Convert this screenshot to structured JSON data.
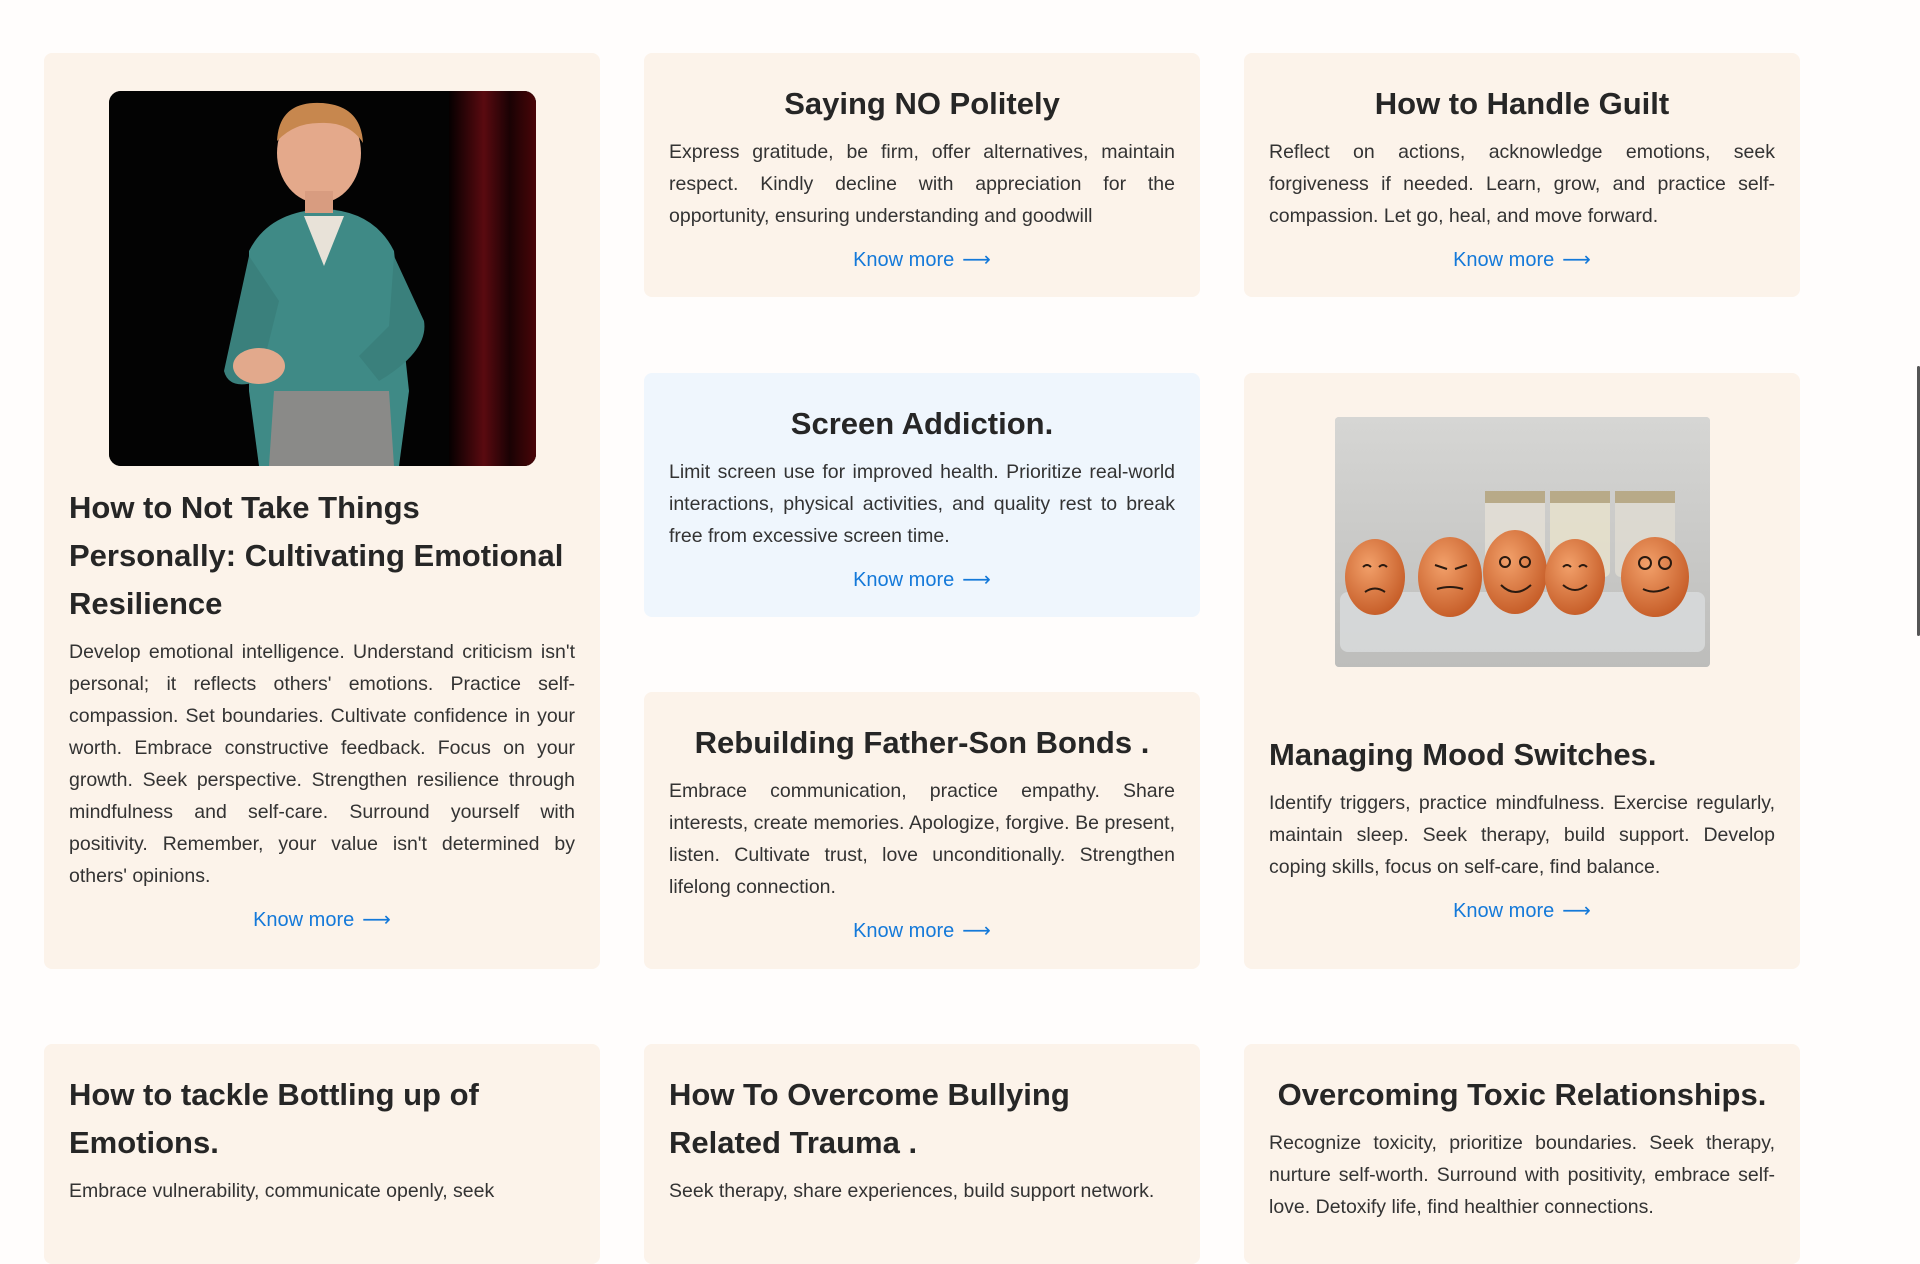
{
  "cards": [
    {
      "title": "How to Not Take Things Personally: Cultivating Emotional Resilience",
      "body": "Develop emotional intelligence. Understand criticism isn't personal; it reflects others' emotions. Practice self-compassion. Set boundaries. Cultivate confidence in your worth. Embrace constructive feedback. Focus on your growth. Seek perspective. Strengthen resilience through mindfulness and self-care. Surround yourself with positivity. Remember, your value isn't determined by others' opinions.",
      "link": "Know more",
      "image": "speaker-on-stage"
    },
    {
      "title": "Saying NO Politely",
      "body": "Express gratitude, be firm, offer alternatives, maintain respect. Kindly decline with appreciation for the opportunity, ensuring understanding and goodwill",
      "link": "Know more"
    },
    {
      "title": "How to Handle Guilt",
      "body": "Reflect on actions, acknowledge emotions, seek forgiveness if needed. Learn, grow, and practice self-compassion. Let go, heal, and move forward.",
      "link": "Know more"
    },
    {
      "title": "Screen Addiction.",
      "body": "Limit screen use for improved health. Prioritize real-world interactions, physical activities, and quality rest to break free from excessive screen time.",
      "link": "Know more"
    },
    {
      "title": "Managing Mood Switches.",
      "body": "Identify triggers, practice mindfulness. Exercise regularly, maintain sleep. Seek therapy, build support. Develop coping skills, focus on self-care, find balance.",
      "link": "Know more",
      "image": "eggs-with-faces"
    },
    {
      "title": "Rebuilding Father-Son Bonds .",
      "body": "Embrace communication, practice empathy. Share interests, create memories. Apologize, forgive. Be present, listen. Cultivate trust, love unconditionally. Strengthen lifelong connection.",
      "link": "Know more"
    },
    {
      "title": "How to tackle Bottling up of Emotions.",
      "body": "Embrace vulnerability, communicate openly, seek"
    },
    {
      "title": "How To Overcome Bullying Related Trauma .",
      "body": "Seek therapy, share experiences, build support network."
    },
    {
      "title": "Overcoming Toxic Relationships.",
      "body": "Recognize toxicity, prioritize boundaries. Seek therapy, nurture self-worth. Surround with positivity, embrace self-love. Detoxify life, find healthier connections."
    }
  ],
  "icons": {
    "link_arrow": "arrow-right-icon"
  },
  "colors": {
    "card_bg": "#fcf3ea",
    "card_blue_bg": "#eff6fd",
    "link": "#1479d9"
  }
}
